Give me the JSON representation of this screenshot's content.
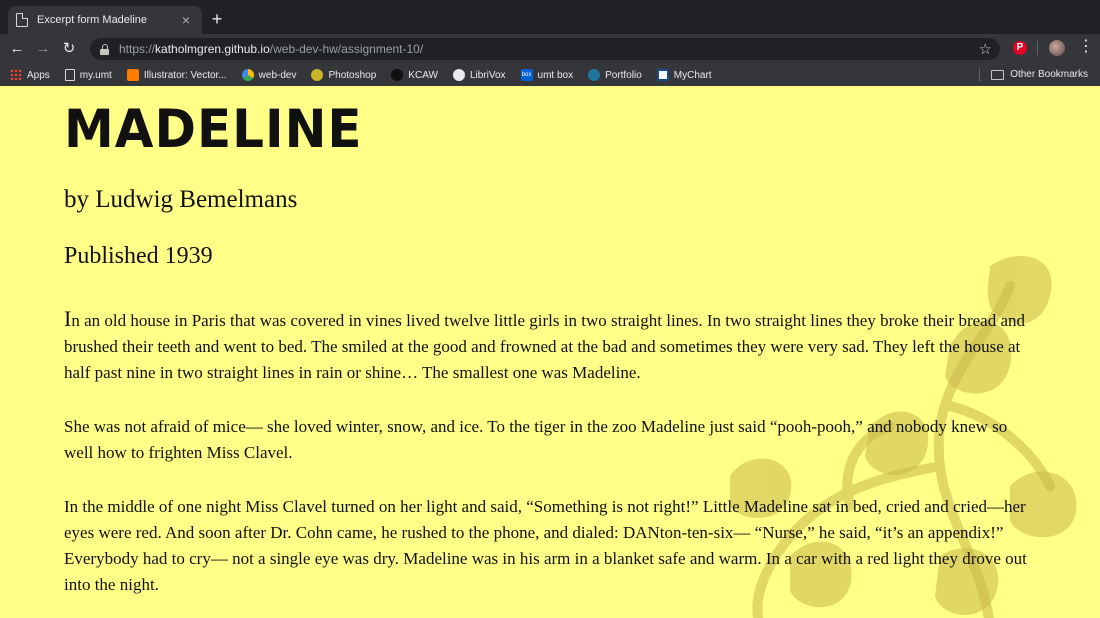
{
  "browser": {
    "tab": {
      "title": "Excerpt form Madeline"
    },
    "url": {
      "scheme": "https://",
      "host": "katholmgren.github.io",
      "path": "/web-dev-hw/assignment-10/"
    },
    "bookmarks": [
      {
        "label": "Apps",
        "icon": "apps-icon"
      },
      {
        "label": "my.umt",
        "icon": "document-icon"
      },
      {
        "label": "Illustrator: Vector...",
        "icon": "illustrator-icon"
      },
      {
        "label": "web-dev",
        "icon": "drive-icon"
      },
      {
        "label": "Photoshop",
        "icon": "photoshop-icon"
      },
      {
        "label": "KCAW",
        "icon": "kcaw-icon"
      },
      {
        "label": "LibriVox",
        "icon": "librivox-icon"
      },
      {
        "label": "umt box",
        "icon": "box-icon"
      },
      {
        "label": "Portfolio",
        "icon": "wordpress-icon"
      },
      {
        "label": "MyChart",
        "icon": "mychart-icon"
      }
    ],
    "other_bookmarks": "Other Bookmarks",
    "box_icon_text": "box",
    "pinterest_text": "P"
  },
  "page": {
    "background": "#ffff88",
    "title": "MADELINE",
    "author": "by Ludwig Bemelmans",
    "published": "Published 1939",
    "paragraphs": [
      {
        "dropcap": "I",
        "text": "n an old house in Paris that was covered in vines lived twelve little girls in two straight lines. In two straight lines they broke their bread and brushed their teeth and went to bed. The smiled at the good and frowned at the bad and sometimes they were very sad. They left the house at half past nine in two straight lines in rain or shine… The smallest one was Madeline."
      },
      {
        "text": "She was not afraid of mice— she loved winter, snow, and ice. To the tiger in the zoo Madeline just said “pooh-pooh,” and nobody knew so well how to frighten Miss Clavel."
      },
      {
        "text": "In the middle of one night Miss Clavel turned on her light and said, “Something is not right!” Little Madeline sat in bed, cried and cried—her eyes were red. And soon after Dr. Cohn came, he rushed to the phone, and dialed: DANton-ten-six— “Nurse,” he said, “it’s an appendix!” Everybody had to cry— not a single eye was dry. Madeline was in his arm in a blanket safe and warm. In a car with a red light they drove out into the night."
      }
    ]
  }
}
